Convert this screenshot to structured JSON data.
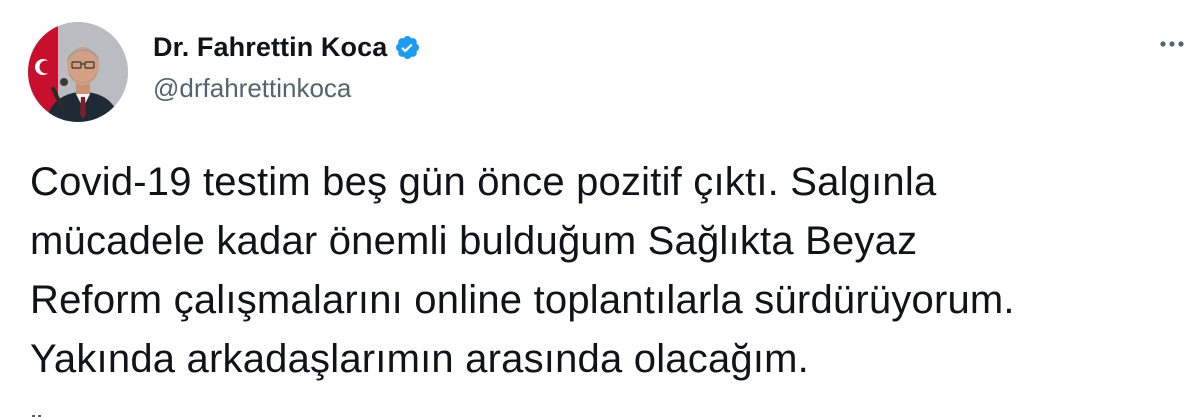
{
  "author": {
    "display_name": "Dr. Fahrettin Koca",
    "handle": "@drfahrettinkoca",
    "verified": true,
    "verified_badge_color": "#1d9bf0",
    "avatar_icon": "profile-photo-icon"
  },
  "tweet": {
    "text": "Covid-19 testim beş gün önce pozitif çıktı. Salgınla\nmücadele kadar önemli bulduğum Sağlıkta Beyaz\nReform çalışmalarını online toplantılarla sürdürüyorum.\nYakında arkadaşlarımın arasında olacağım."
  },
  "menu": {
    "icon": "more-options-icon"
  },
  "colors": {
    "text_primary": "#0f1419",
    "text_secondary": "#536471",
    "accent": "#1d9bf0"
  }
}
